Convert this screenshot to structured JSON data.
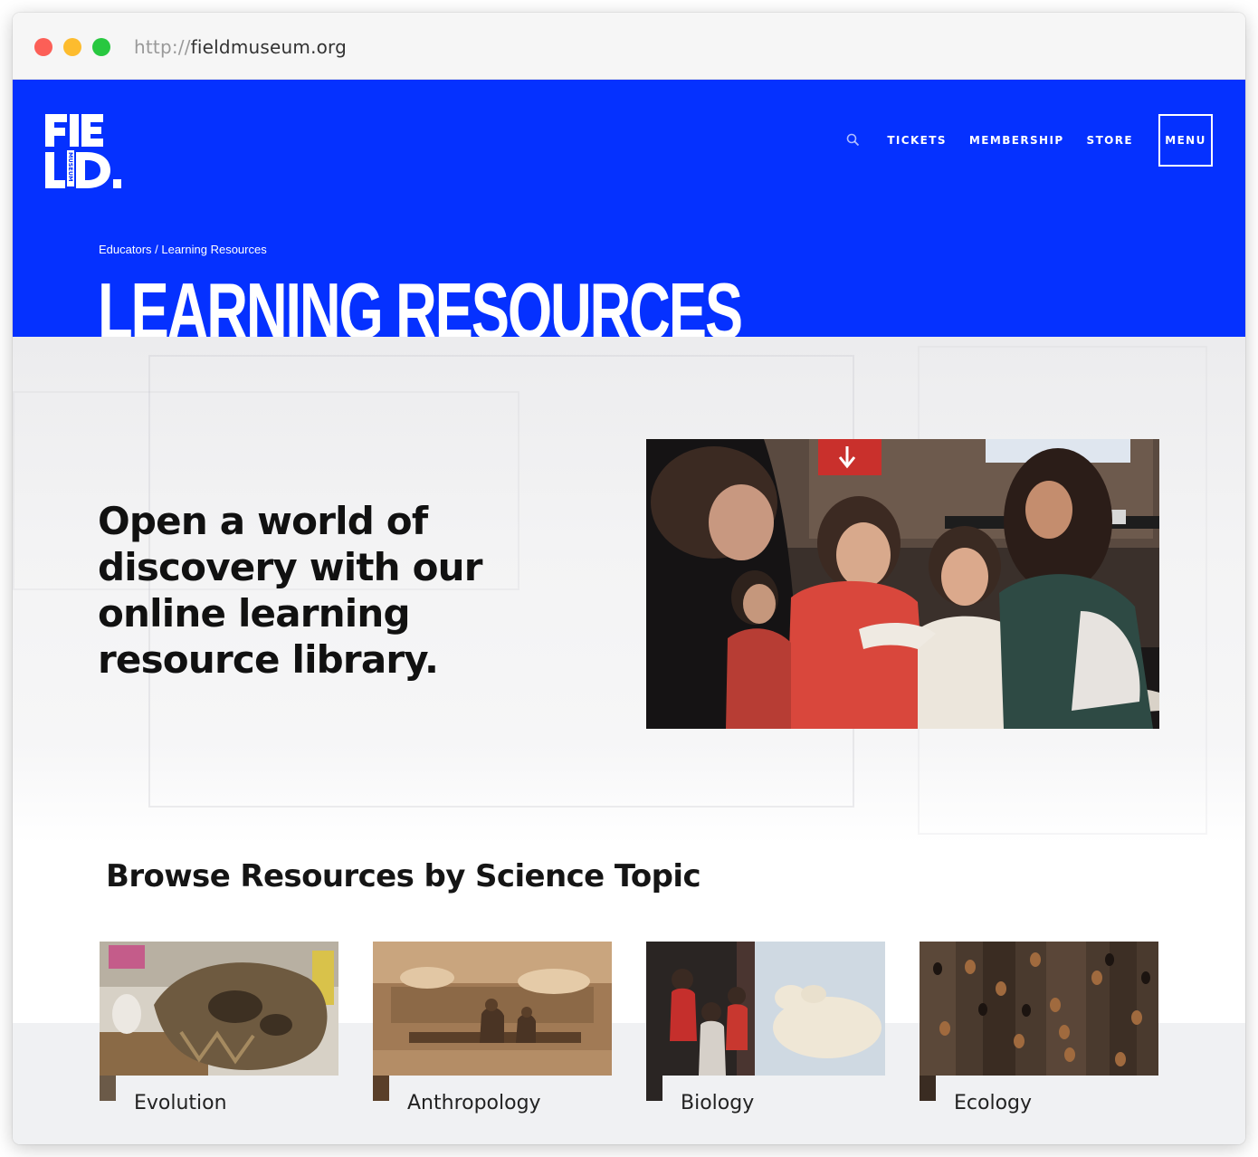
{
  "browser": {
    "url_protocol": "http://",
    "url_host": "fieldmuseum.org"
  },
  "header": {
    "logo_text": "FIELD MUSEUM",
    "nav": {
      "tickets": "TICKETS",
      "membership": "MEMBERSHIP",
      "store": "STORE",
      "menu": "MENU"
    },
    "breadcrumb": "Educators / Learning Resources",
    "title": "LEARNING RESOURCES"
  },
  "intro": {
    "headline": "Open a world of discovery with our online learning resource library."
  },
  "browse": {
    "title": "Browse Resources by Science Topic",
    "topics": [
      {
        "label": "Evolution"
      },
      {
        "label": "Anthropology"
      },
      {
        "label": "Biology"
      },
      {
        "label": "Ecology"
      }
    ]
  },
  "colors": {
    "brand_blue": "#0531ff",
    "text_dark": "#111111",
    "band_grey": "#f0f1f3"
  },
  "icons": [
    "search-icon",
    "field-museum-logo"
  ]
}
